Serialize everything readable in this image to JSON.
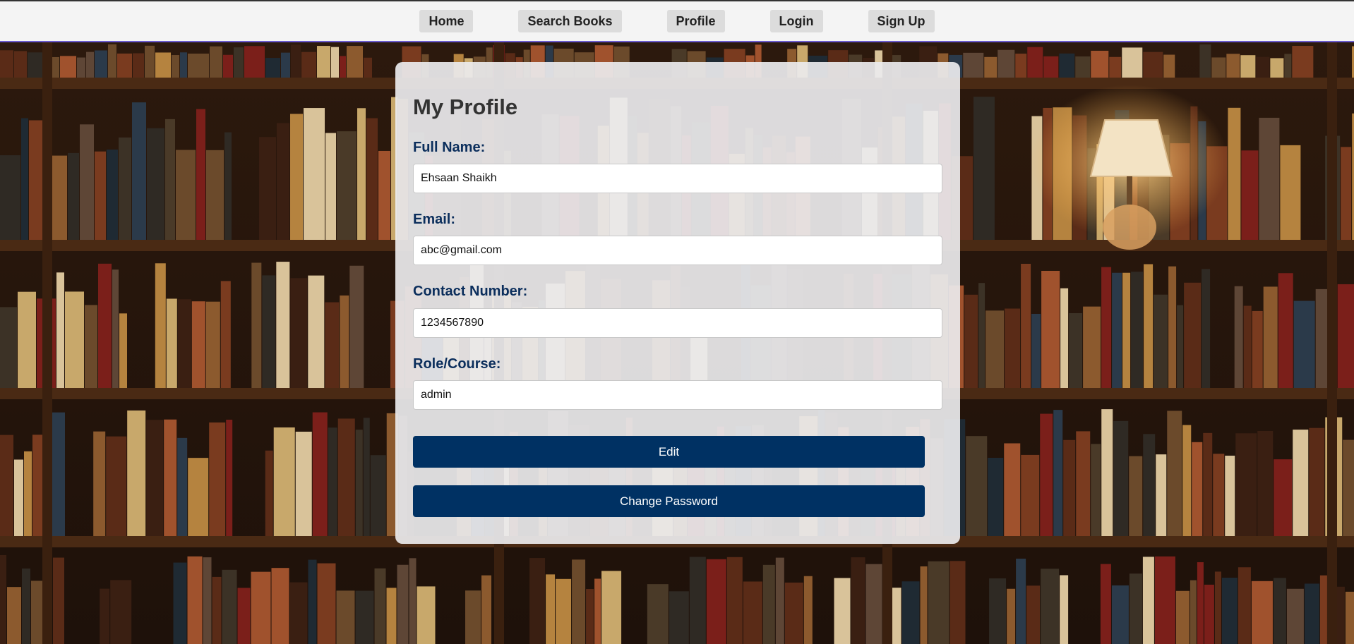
{
  "nav": {
    "items": [
      {
        "label": "Home"
      },
      {
        "label": "Search Books"
      },
      {
        "label": "Profile"
      },
      {
        "label": "Login"
      },
      {
        "label": "Sign Up"
      }
    ]
  },
  "profile": {
    "title": "My Profile",
    "fields": [
      {
        "label": "Full Name:",
        "value": "Ehsaan Shaikh"
      },
      {
        "label": "Email:",
        "value": "abc@gmail.com"
      },
      {
        "label": "Contact Number:",
        "value": "1234567890"
      },
      {
        "label": "Role/Course:",
        "value": "admin"
      }
    ],
    "edit_label": "Edit",
    "change_password_label": "Change Password"
  },
  "colors": {
    "label_text": "#0b2e5c",
    "button_bg": "#003163",
    "nav_bg": "#f4f4f4"
  }
}
